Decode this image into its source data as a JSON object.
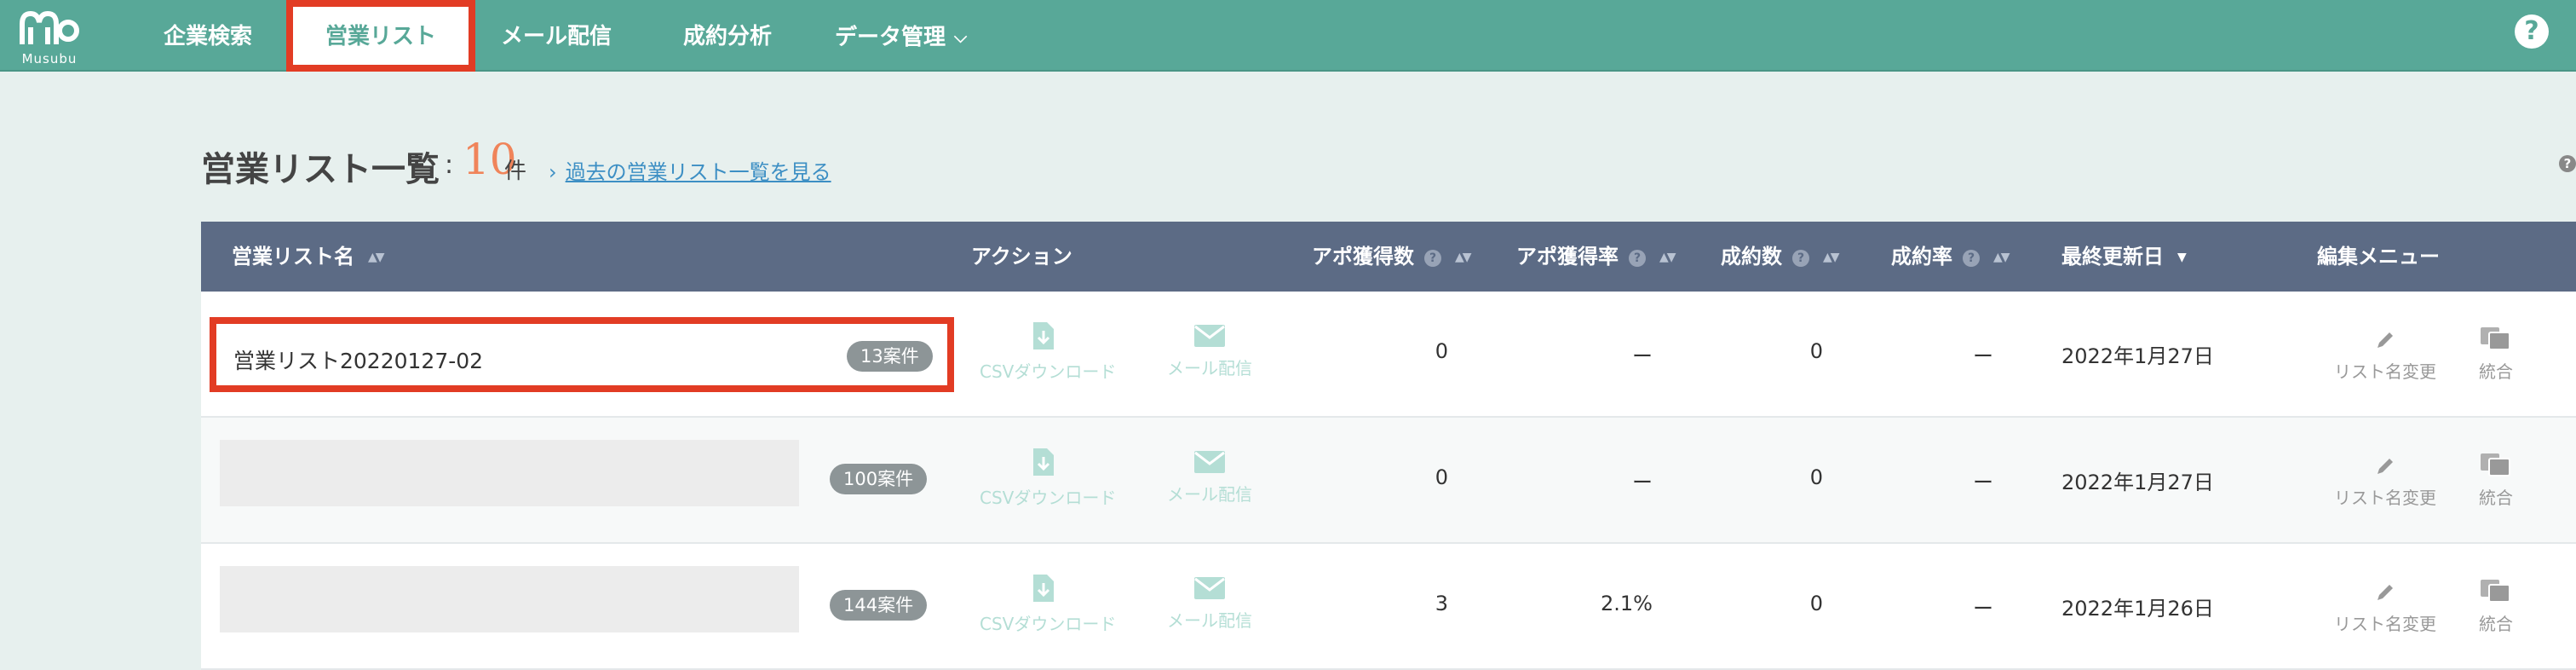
{
  "nav": {
    "brand": "Musubu",
    "items": [
      "企業検索",
      "営業リスト",
      "メール配信",
      "成約分析",
      "データ管理"
    ],
    "dropdown_chevron": "chevron-down-icon"
  },
  "header": {
    "title": "営業リスト一覧",
    "colon": ":",
    "count": "10",
    "count_unit": "件",
    "past_link": "過去の営業リスト一覧を見る"
  },
  "table": {
    "columns": {
      "name": "営業リスト名",
      "action": "アクション",
      "appo_count": "アポ獲得数",
      "appo_rate": "アポ獲得率",
      "deal_count": "成約数",
      "deal_rate": "成約率",
      "updated": "最終更新日",
      "edit_menu": "編集メニュー"
    },
    "action_labels": {
      "csv": "CSVダウンロード",
      "mail": "メール配信"
    },
    "edit_labels": {
      "rename": "リスト名変更",
      "merge": "統合"
    },
    "rows": [
      {
        "name": "営業リスト20220127-02",
        "cases": "13案件",
        "appo_count": "0",
        "appo_rate": "ー",
        "deal_count": "0",
        "deal_rate": "ー",
        "updated": "2022年1月27日"
      },
      {
        "name": "",
        "cases": "100案件",
        "appo_count": "0",
        "appo_rate": "ー",
        "deal_count": "0",
        "deal_rate": "ー",
        "updated": "2022年1月27日"
      },
      {
        "name": "",
        "cases": "144案件",
        "appo_count": "3",
        "appo_rate": "2.1%",
        "deal_count": "0",
        "deal_rate": "ー",
        "updated": "2022年1月26日"
      }
    ]
  },
  "colors": {
    "nav_bg": "#58a898",
    "page_bg": "#e7f0ee",
    "table_header_bg": "#5c6b85",
    "highlight": "#e23c24",
    "count_accent": "#f0845a",
    "link": "#3d8fc4"
  }
}
